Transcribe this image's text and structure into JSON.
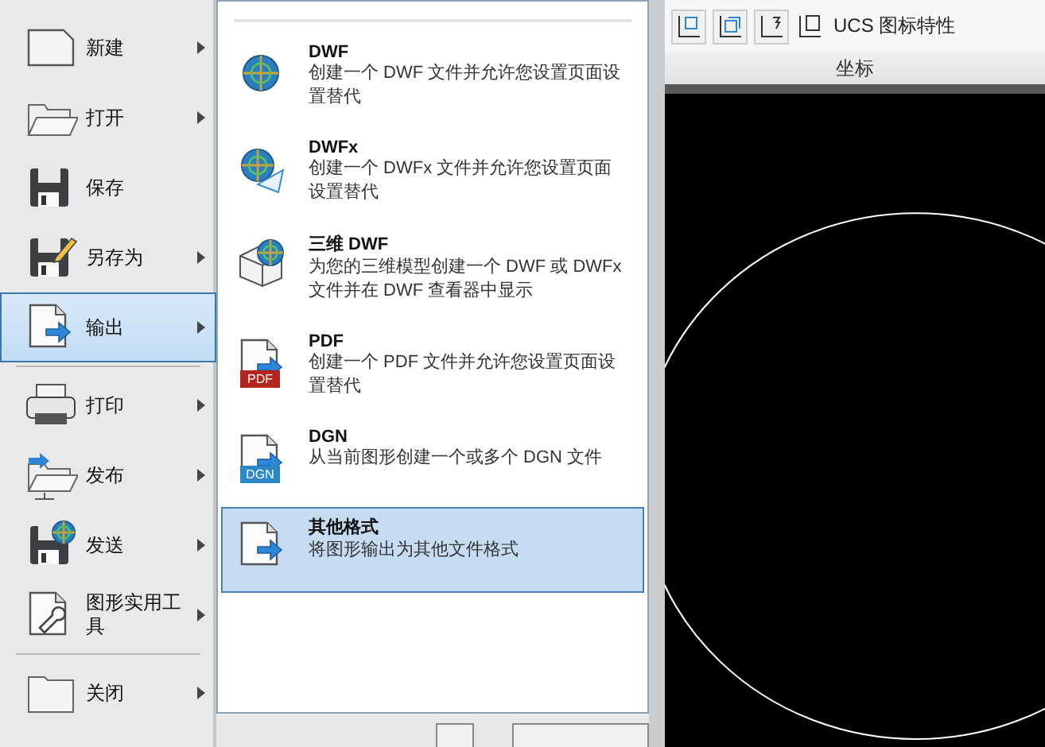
{
  "app_menu": {
    "groups": [
      [
        {
          "label": "新建",
          "kind": "new",
          "has_submenu": true,
          "selected": false
        },
        {
          "label": "打开",
          "kind": "open",
          "has_submenu": true,
          "selected": false
        },
        {
          "label": "保存",
          "kind": "save",
          "has_submenu": false,
          "selected": false
        },
        {
          "label": "另存为",
          "kind": "saveas",
          "has_submenu": true,
          "selected": false
        },
        {
          "label": "输出",
          "kind": "export",
          "has_submenu": true,
          "selected": true
        }
      ],
      [
        {
          "label": "打印",
          "kind": "print",
          "has_submenu": true,
          "selected": false
        },
        {
          "label": "发布",
          "kind": "publish",
          "has_submenu": true,
          "selected": false
        },
        {
          "label": "发送",
          "kind": "send",
          "has_submenu": true,
          "selected": false
        },
        {
          "label": "图形实用工具",
          "kind": "utilities",
          "has_submenu": true,
          "selected": false
        }
      ],
      [
        {
          "label": "关闭",
          "kind": "close",
          "has_submenu": true,
          "selected": false
        }
      ]
    ]
  },
  "submenu": {
    "items": [
      {
        "title": "DWF",
        "description": "创建一个 DWF 文件并允许您设置页面设置替代",
        "kind": "dwf",
        "selected": false
      },
      {
        "title": "DWFx",
        "description": "创建一个 DWFx 文件并允许您设置页面设置替代",
        "kind": "dwfx",
        "selected": false
      },
      {
        "title": "三维 DWF",
        "description": "为您的三维模型创建一个 DWF 或 DWFx 文件并在 DWF 查看器中显示",
        "kind": "dwf3d",
        "selected": false
      },
      {
        "title": "PDF",
        "description": "创建一个 PDF 文件并允许您设置页面设置替代",
        "kind": "pdf",
        "badge": "PDF",
        "selected": false
      },
      {
        "title": "DGN",
        "description": "从当前图形创建一个或多个 DGN 文件",
        "kind": "dgn",
        "badge": "DGN",
        "selected": false
      },
      {
        "title": "其他格式",
        "description": "将图形输出为其他文件格式",
        "kind": "other",
        "selected": true
      }
    ]
  },
  "ribbon": {
    "tool_label": "UCS 图标特性",
    "panel_title": "坐标"
  }
}
